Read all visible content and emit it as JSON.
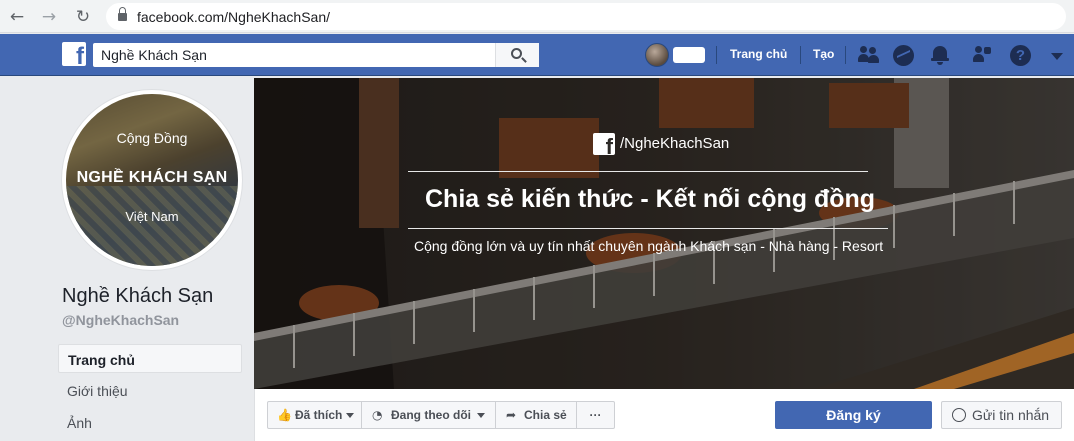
{
  "browser": {
    "back_icon": "back-arrow-icon",
    "forward_icon": "forward-arrow-icon",
    "reload_icon": "reload-icon",
    "url": "facebook.com/NgheKhachSan/"
  },
  "fb_header": {
    "logo_letter": "f",
    "search_value": "Nghề Khách Sạn",
    "nav": [
      "Trang chủ",
      "Tạo"
    ],
    "icons": [
      "friends-icon",
      "messenger-icon",
      "notifications-icon",
      "quick-help-icon",
      "help-icon",
      "account-menu-icon"
    ],
    "brand_color": "#4267b2"
  },
  "page": {
    "profile_text": [
      "Cộng Đồng",
      "NGHỀ KHÁCH SẠN",
      "Việt Nam"
    ],
    "name": "Nghề Khách Sạn",
    "handle": "@NgheKhachSan",
    "left_nav": [
      "Trang chủ",
      "Giới thiệu",
      "Ảnh"
    ]
  },
  "cover": {
    "handle": "/NgheKhachSan",
    "title": "Chia sẻ kiến thức - Kết nối cộng đồng",
    "subtitle": "Cộng đồng lớn và uy tín nhất chuyên ngành Khách sạn - Nhà hàng - Resort"
  },
  "actions": {
    "liked": "Đã thích",
    "following": "Đang theo dõi",
    "share": "Chia sẻ",
    "more": "···",
    "signup": "Đăng ký",
    "send_message": "Gửi tin nhắn"
  }
}
